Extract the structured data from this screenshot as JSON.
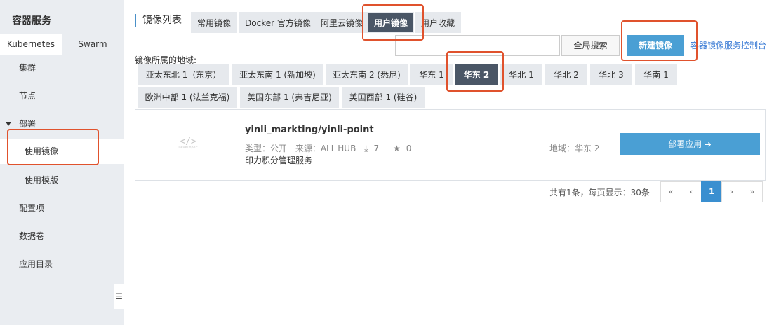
{
  "sidebar": {
    "title": "容器服务",
    "tabs": [
      "Kubernetes",
      "Swarm"
    ],
    "items": [
      {
        "label": "集群"
      },
      {
        "label": "节点"
      },
      {
        "label": "部署"
      },
      {
        "label": "使用镜像"
      },
      {
        "label": "使用模版"
      },
      {
        "label": "配置项"
      },
      {
        "label": "数据卷"
      },
      {
        "label": "应用目录"
      }
    ],
    "collapse_icon": "☰"
  },
  "header": {
    "title": "镜像列表",
    "tabs": [
      "常用镜像",
      "Docker 官方镜像",
      "阿里云镜像",
      "用户镜像",
      "用户收藏"
    ],
    "active_tab": "用户镜像"
  },
  "toolbar": {
    "search_value": "",
    "search_placeholder": "",
    "global_search_label": "全局搜索",
    "new_image_label": "新建镜像",
    "console_link": "容器镜像服务控制台"
  },
  "regions": {
    "label": "镜像所属的地域:",
    "items": [
      "亚太东北 1（东京）",
      "亚太东南 1 (新加坡)",
      "亚太东南 2 (悉尼)",
      "华东 1",
      "华东 2",
      "华北 1",
      "华北 2",
      "华北 3",
      "华南 1",
      "欧洲中部 1 (法兰克福)",
      "美国东部 1 (弗吉尼亚)",
      "美国西部 1 (硅谷)"
    ],
    "active": "华东 2"
  },
  "result": {
    "icon_glyph": "</>",
    "icon_caption": "Developer",
    "name": "yinli_markting/yinli-point",
    "type": "类型：公开",
    "source": "来源：ALI_HUB",
    "downloads": "7",
    "stars": "0",
    "description": "印力积分管理服务",
    "region": "地域：华东 2",
    "deploy_label": "部署应用 ➜"
  },
  "pagination": {
    "summary": "共有1条，每页显示：30条",
    "first": "«",
    "prev": "‹",
    "current": "1",
    "next": "›",
    "last": "»"
  },
  "colors": {
    "accent": "#4a9fd4",
    "active_tab": "#4a5666",
    "annotation": "#e0522d"
  }
}
